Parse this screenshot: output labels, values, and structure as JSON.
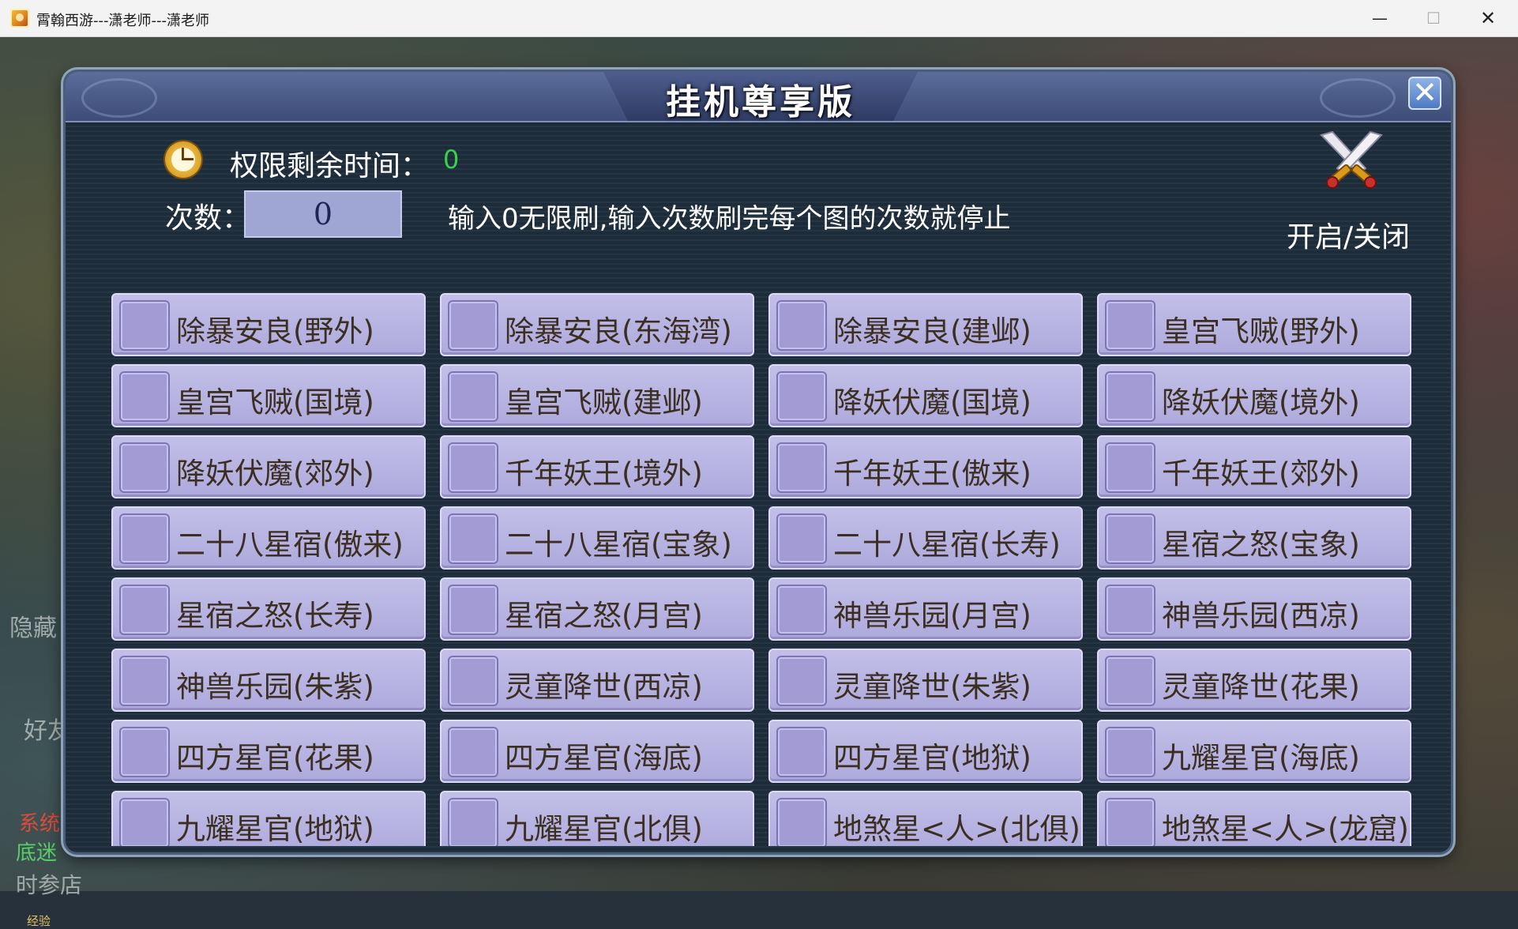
{
  "window": {
    "title": "霄翰西游---潇老师---潇老师",
    "min_glyph": "—",
    "max_glyph": "☐",
    "close_glyph": "✕"
  },
  "background": {
    "left_hidden": "隐藏",
    "left_friend": "好友",
    "left_system": "系统",
    "left_bottom": "底迷",
    "left_time": "时参店",
    "left_exp": "经验"
  },
  "panel": {
    "title": "挂机尊享版",
    "close_glyph": "✕",
    "time_label": "权限剩余时间：",
    "time_value": "0",
    "count_label": "次数：",
    "count_value": "0",
    "count_hint": "输入0无限刷,输入次数刷完每个图的次数就停止",
    "toggle_label": "开启/关闭"
  },
  "tasks": [
    "除暴安良(野外)",
    "除暴安良(东海湾)",
    "除暴安良(建邺)",
    "皇宫飞贼(野外)",
    "皇宫飞贼(国境)",
    "皇宫飞贼(建邺)",
    "降妖伏魔(国境)",
    "降妖伏魔(境外)",
    "降妖伏魔(郊外)",
    "千年妖王(境外)",
    "千年妖王(傲来)",
    "千年妖王(郊外)",
    "二十八星宿(傲来)",
    "二十八星宿(宝象)",
    "二十八星宿(长寿)",
    "星宿之怒(宝象)",
    "星宿之怒(长寿)",
    "星宿之怒(月宫)",
    "神兽乐园(月宫)",
    "神兽乐园(西凉)",
    "神兽乐园(朱紫)",
    "灵童降世(西凉)",
    "灵童降世(朱紫)",
    "灵童降世(花果)",
    "四方星官(花果)",
    "四方星官(海底)",
    "四方星官(地狱)",
    "九耀星官(海底)",
    "九耀星官(地狱)",
    "九耀星官(北俱)",
    "地煞星<人>(北俱)",
    "地煞星<人>(龙窟)"
  ]
}
